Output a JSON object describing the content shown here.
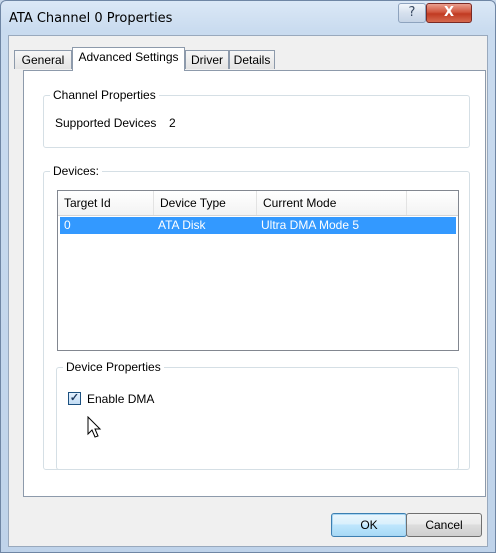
{
  "window": {
    "title": "ATA Channel 0 Properties",
    "help_glyph": "?",
    "close_glyph": "X"
  },
  "tabs": [
    {
      "label": "General",
      "active": false
    },
    {
      "label": "Advanced Settings",
      "active": true
    },
    {
      "label": "Driver",
      "active": false
    },
    {
      "label": "Details",
      "active": false
    }
  ],
  "channel_properties": {
    "legend": "Channel Properties",
    "supported_devices_label": "Supported Devices",
    "supported_devices_value": "2"
  },
  "devices": {
    "legend": "Devices:",
    "columns": [
      "Target Id",
      "Device Type",
      "Current Mode"
    ],
    "rows": [
      {
        "target_id": "0",
        "device_type": "ATA Disk",
        "current_mode": "Ultra DMA Mode 5",
        "selected": true
      }
    ]
  },
  "device_properties": {
    "legend": "Device Properties",
    "enable_dma_label": "Enable DMA",
    "enable_dma_checked": true,
    "check_glyph": "✓"
  },
  "buttons": {
    "ok": "OK",
    "cancel": "Cancel"
  },
  "colors": {
    "selection": "#3399ff",
    "close_button": "#c13a22"
  }
}
